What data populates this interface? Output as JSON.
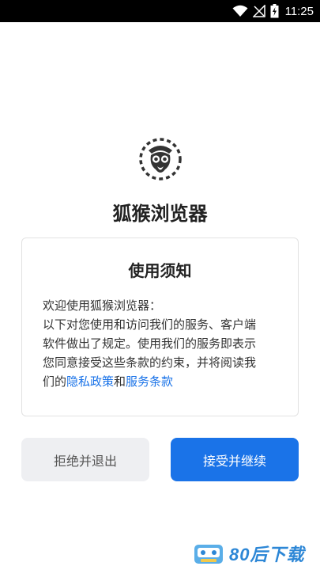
{
  "status_bar": {
    "time": "11:25",
    "icons": [
      "wifi-icon",
      "no-signal-icon",
      "battery-charging-icon"
    ]
  },
  "app": {
    "title": "狐猴浏览器",
    "logo_icon": "lemur-icon"
  },
  "notice": {
    "title": "使用须知",
    "lines": [
      "欢迎使用狐猴浏览器：",
      "以下对您使用和访问我们的服务、客户端",
      "软件做出了规定。使用我们的服务即表示",
      "您同意接受这些条款的约束，并将阅读我"
    ],
    "last_line_prefix": "们的",
    "privacy_link": "隐私政策",
    "and_text": "和",
    "terms_link": "服务条款",
    "link_color": "#1a73e8"
  },
  "buttons": {
    "decline_label": "拒绝并退出",
    "accept_label": "接受并继续",
    "accept_color": "#1a73e8"
  },
  "watermark": {
    "text": "80后下载"
  }
}
